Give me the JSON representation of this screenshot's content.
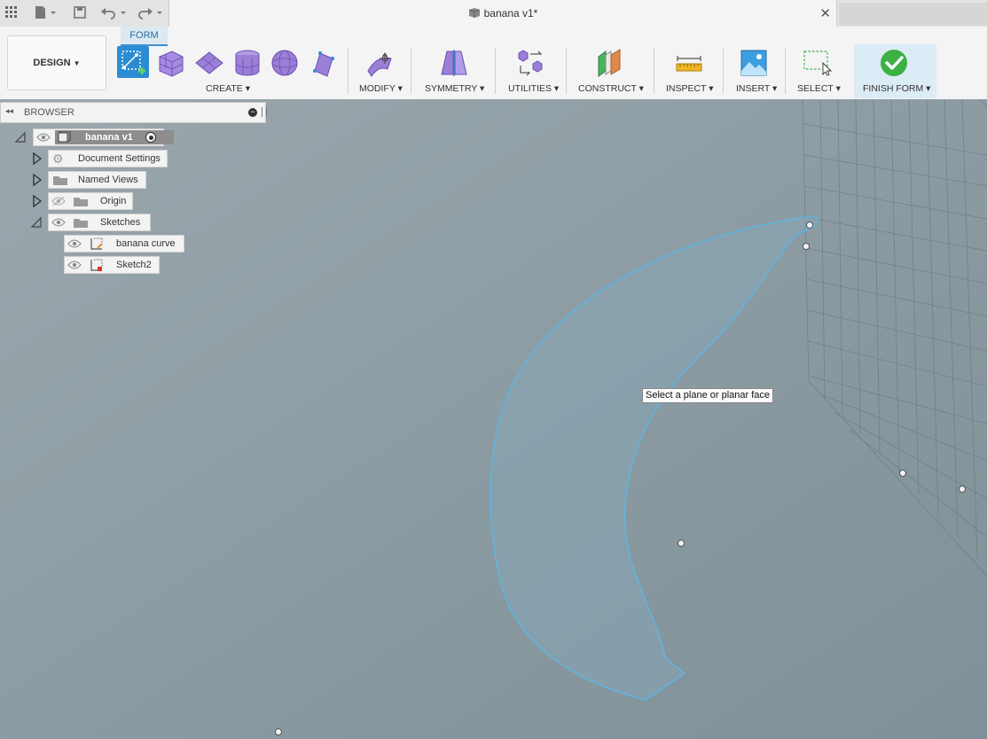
{
  "window": {
    "doc_title": "banana v1*"
  },
  "toolbar": {
    "workspace_label": "DESIGN",
    "active_tab": "FORM",
    "groups": {
      "create": "CREATE",
      "modify": "MODIFY",
      "symmetry": "SYMMETRY",
      "utilities": "UTILITIES",
      "construct": "CONSTRUCT",
      "inspect": "INSPECT",
      "insert": "INSERT",
      "select": "SELECT",
      "finish": "FINISH FORM"
    }
  },
  "browser": {
    "title": "BROWSER",
    "root": "banana v1",
    "items": {
      "document_settings": "Document Settings",
      "named_views": "Named Views",
      "origin": "Origin",
      "sketches": "Sketches",
      "sketch_banana": "banana curve",
      "sketch2": "Sketch2"
    }
  },
  "viewport": {
    "tooltip": "Select a plane or planar face"
  },
  "colors": {
    "accent": "#3a90d0",
    "form_purple": "#9b7fd6",
    "finish_green": "#3cb043",
    "curve_blue": "#5fb4e0"
  },
  "icons": [
    "apps-grid-icon",
    "file-icon",
    "save-icon",
    "undo-icon",
    "redo-icon",
    "box-icon",
    "close-icon",
    "eye-icon",
    "gear-icon",
    "folder-icon",
    "sketch-icon",
    "checkmark-icon"
  ]
}
